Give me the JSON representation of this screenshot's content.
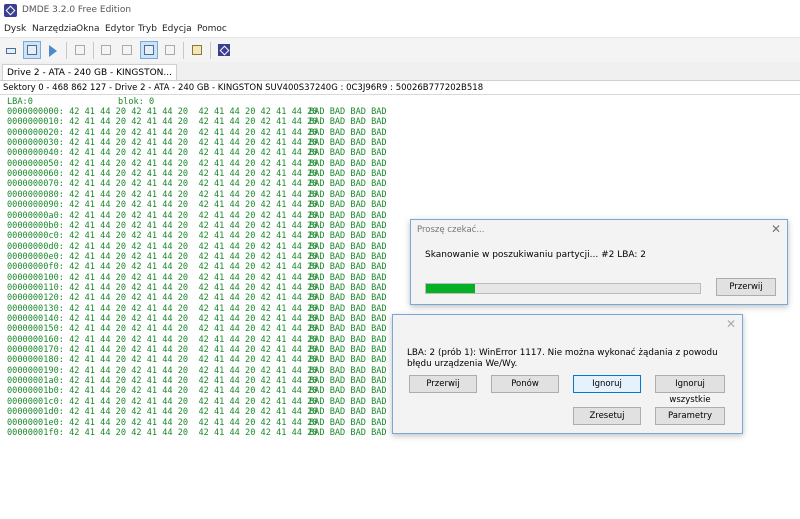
{
  "window": {
    "title": "DMDE 3.2.0 Free Edition"
  },
  "menu": [
    "Dysk",
    "Narzędzia",
    "Okna",
    "Edytor",
    "Tryb",
    "Edycja",
    "Pomoc"
  ],
  "tab": {
    "label": "Drive 2 - ATA - 240 GB - KINGSTON..."
  },
  "info": {
    "text": "Sektory 0 - 468 862 127 - Drive 2 - ATA - 240 GB - KINGSTON SUV400S37240G : 0C3J96R9 : 50026B777202B518"
  },
  "hex": {
    "lba_label": "LBA:0",
    "blok_label": "blok: 0",
    "row_bytes": "42 41 44 20 42 41 44 20  42 41 44 20 42 41 44 20",
    "row_ascii": "BAD BAD BAD BAD",
    "addresses": [
      "0000000000",
      "0000000010",
      "0000000020",
      "0000000030",
      "0000000040",
      "0000000050",
      "0000000060",
      "0000000070",
      "0000000080",
      "0000000090",
      "00000000a0",
      "00000000b0",
      "00000000c0",
      "00000000d0",
      "00000000e0",
      "00000000f0",
      "0000000100",
      "0000000110",
      "0000000120",
      "0000000130",
      "0000000140",
      "0000000150",
      "0000000160",
      "0000000170",
      "0000000180",
      "0000000190",
      "00000001a0",
      "00000001b0",
      "00000001c0",
      "00000001d0",
      "00000001e0",
      "00000001f0"
    ]
  },
  "progress_dialog": {
    "title": "Proszę czekać...",
    "message": "Skanowanie w poszukiwaniu partycji... #2  LBA: 2",
    "progress": 0.18,
    "button": "Przerwij"
  },
  "error_dialog": {
    "message": "LBA: 2 (prób 1): WinError 1117. Nie można wykonać żądania z powodu błędu urządzenia We/Wy.",
    "buttons": {
      "przerwij": "Przerwij",
      "ponow": "Ponów",
      "ignoruj": "Ignoruj",
      "ignoruj_wszystkie": "Ignoruj wszystkie",
      "zresetuj": "Zresetuj",
      "parametry": "Parametry"
    }
  }
}
